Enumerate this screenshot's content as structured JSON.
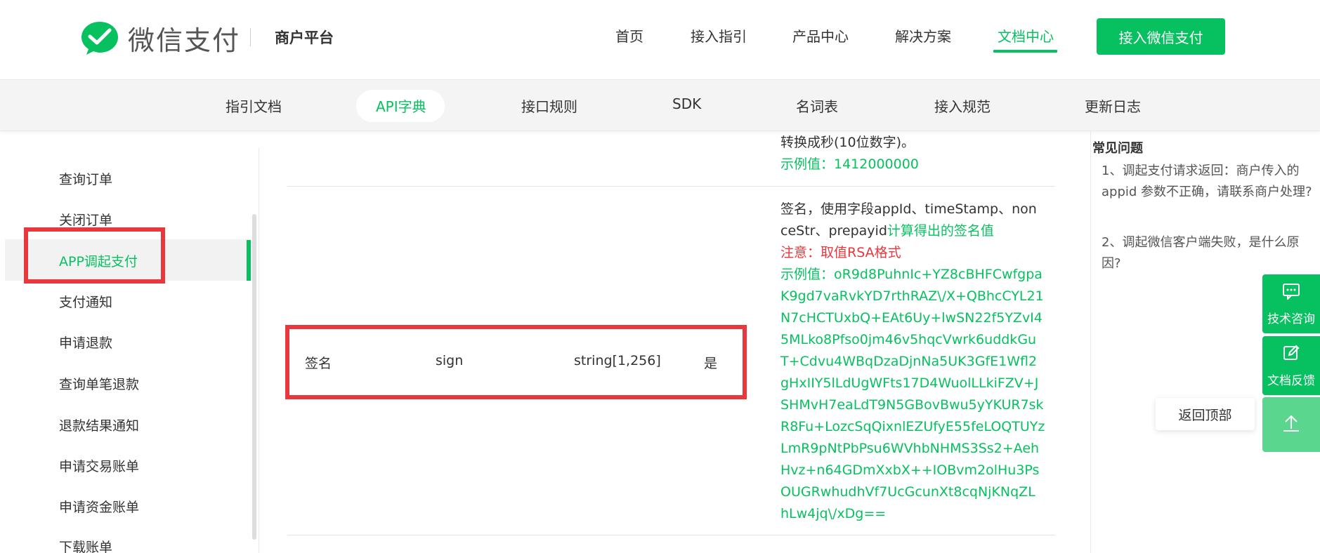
{
  "header": {
    "logo_text": "微信支付",
    "logo_sub": "商户平台",
    "nav": [
      "首页",
      "接入指引",
      "产品中心",
      "解决方案",
      "文档中心"
    ],
    "active_nav": "文档中心",
    "cta_label": "接入微信支付"
  },
  "subnav": {
    "items": [
      "指引文档",
      "API字典",
      "接口规则",
      "SDK",
      "名词表",
      "接入规范",
      "更新日志"
    ],
    "active": "API字典"
  },
  "sidebar": {
    "items": [
      "查询订单",
      "关闭订单",
      "APP调起支付",
      "支付通知",
      "申请退款",
      "查询单笔退款",
      "退款结果通知",
      "申请交易账单",
      "申请资金账单",
      "下载账单"
    ],
    "active": "APP调起支付"
  },
  "content": {
    "prev_row": {
      "desc_tail": "转换成秒(10位数字)。",
      "example": "示例值：1412000000"
    },
    "row": {
      "name": "签名",
      "field": "sign",
      "type": "string[1,256]",
      "required": "是",
      "desc_line1": "签名，使用字段appId、timeStamp、non",
      "desc_line2_black": "ceStr、prepayid",
      "desc_line2_green": "计算得出的签名值",
      "note": "注意：取值RSA格式",
      "example_lines": [
        "示例值：oR9d8PuhnIc+YZ8cBHFCwfgpa",
        "K9gd7vaRvkYD7rthRAZ\\/X+QBhcCYL21",
        "N7cHCTUxbQ+EAt6Uy+lwSN22f5YZvI4",
        "5MLko8Pfso0jm46v5hqcVwrk6uddkGu",
        "T+Cdvu4WBqDzaDjnNa5UK3GfE1Wfl2",
        "gHxIIY5lLdUgWFts17D4WuolLLkiFZV+J",
        "SHMvH7eaLdT9N5GBovBwu5yYKUR7sk",
        "R8Fu+LozcSqQixnlEZUfyE55feLOQTUYz",
        "LmR9pNtPbPsu6WVhbNHMS3Ss2+Aeh",
        "Hvz+n64GDmXxbX++IOBvm2olHu3Ps",
        "OUGRwhudhVf7UcGcunXt8cqNjKNqZL",
        "hLw4jq\\/xDg=="
      ]
    }
  },
  "faq": {
    "title": "常见问题",
    "questions": [
      "1、调起支付请求返回：商户传入的appid 参数不正确，请联系商户处理?",
      "2、调起微信客户端失败，是什么原因?"
    ]
  },
  "floating": {
    "tech_label": "技术咨询",
    "feedback_label": "文档反馈",
    "back_top_label": "返回顶部"
  },
  "colors": {
    "brand_green": "#07c160",
    "highlight_red": "#e8383d"
  },
  "icons": {
    "logo": "wechat-pay-logo-icon",
    "tech": "chat-bubble-icon",
    "feedback": "edit-note-icon",
    "back_top": "arrow-up-icon"
  }
}
